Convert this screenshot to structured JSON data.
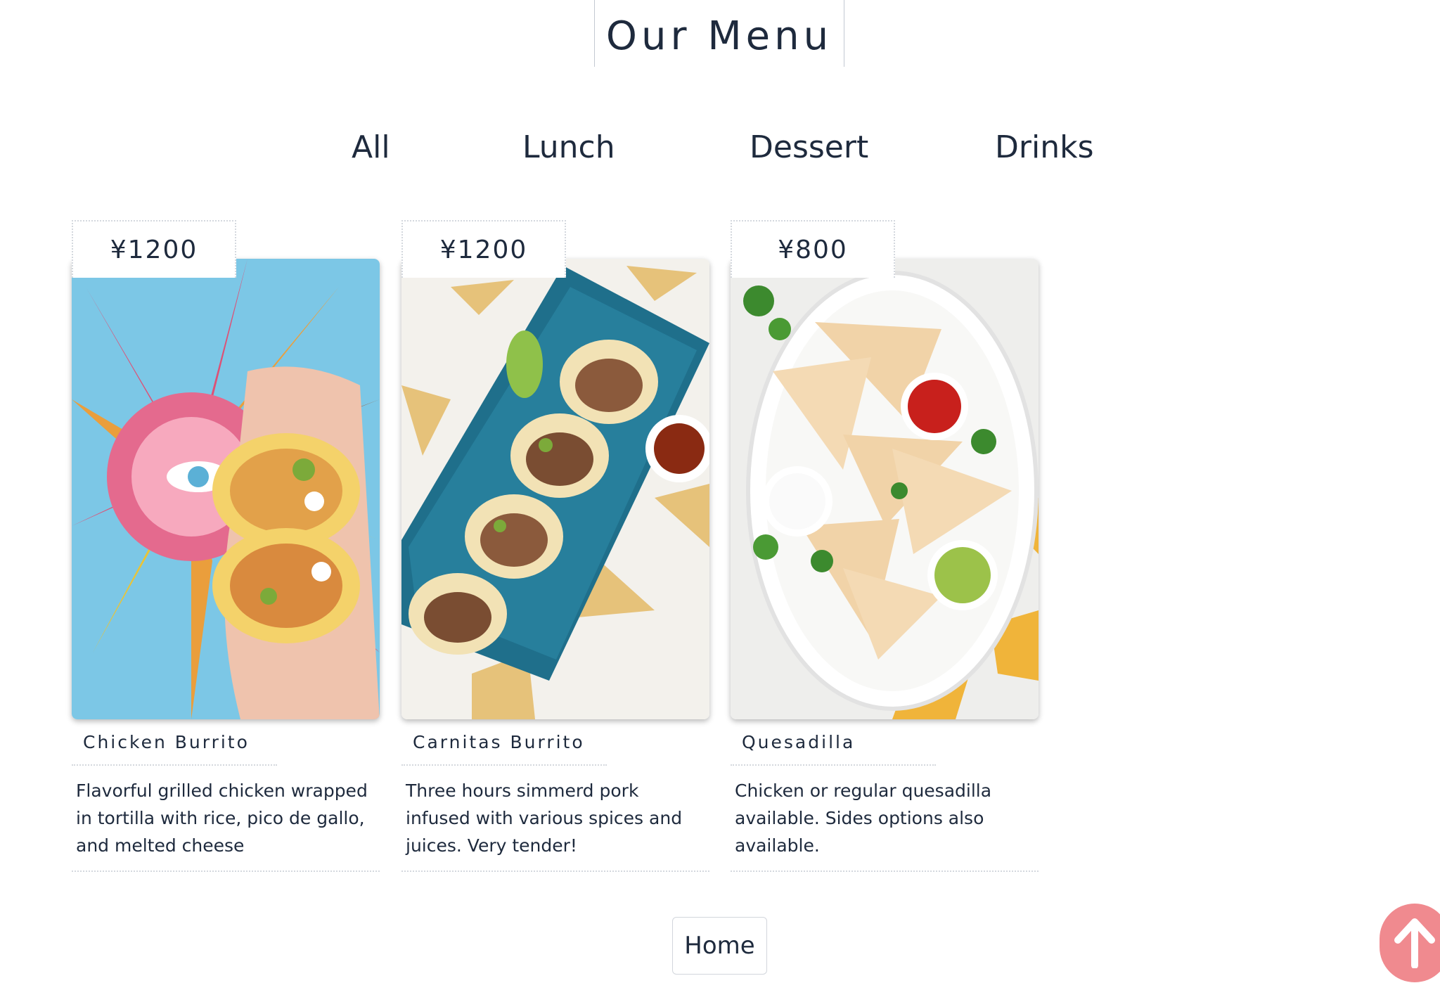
{
  "header": {
    "title": "Our Menu"
  },
  "tabs": [
    {
      "label": "All"
    },
    {
      "label": "Lunch"
    },
    {
      "label": "Dessert"
    },
    {
      "label": "Drinks"
    }
  ],
  "items": [
    {
      "price": "¥1200",
      "name": "Chicken Burrito",
      "description": "Flavorful grilled chicken wrapped in tortilla with rice, pico de gallo, and melted cheese"
    },
    {
      "price": "¥1200",
      "name": "Carnitas Burrito",
      "description": "Three hours simmerd pork infused with various spices and juices. Very tender!"
    },
    {
      "price": "¥800",
      "name": "Quesadilla",
      "description": "Chicken or regular quesadilla available. Sides options also available."
    }
  ],
  "footer": {
    "home_label": "Home",
    "scroll_top_icon": "arrow-up-icon"
  },
  "colors": {
    "text": "#1e2a3d",
    "scroll_top_button": "#f08a8f"
  }
}
